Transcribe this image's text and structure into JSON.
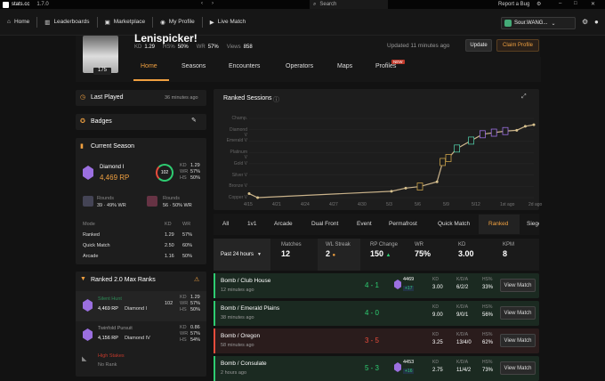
{
  "app": {
    "name": "stats.cc",
    "version": "1.7.0"
  },
  "titlebar": {
    "search_placeholder": "Search",
    "report_bug": "Report a Bug"
  },
  "nav": {
    "home": "Home",
    "leaderboards": "Leaderboards",
    "marketplace": "Marketplace",
    "my_profile": "My Profile",
    "live_match": "Live Match",
    "user": "Sour.WANG..."
  },
  "profile": {
    "name": "Lenispicker!",
    "level": "175",
    "kd_label": "KD",
    "kd": "1.29",
    "hs_label": "HS%",
    "hs": "50%",
    "wr_label": "WR",
    "wr": "57%",
    "views_label": "Views",
    "views": "858",
    "updated": "Updated 11 minutes ago",
    "update_btn": "Update",
    "claim_btn": "Claim Profile"
  },
  "tabs": [
    "Home",
    "Seasons",
    "Encounters",
    "Operators",
    "Maps",
    "Profiles"
  ],
  "new_badge": "NEW",
  "left": {
    "last_played_label": "Last Played",
    "last_played_value": "36 minutes ago",
    "badges_label": "Badges",
    "current_season_label": "Current Season",
    "rank": "Diamond I",
    "rp": "4,469 RP",
    "ring": "102",
    "kd_label": "KD",
    "kd": "1.29",
    "wr_label": "WR",
    "wr": "57%",
    "hs_label": "HS",
    "hs": "50%",
    "rounds1_label": "Rounds",
    "rounds1": "39 · 49% WR",
    "rounds2_label": "Rounds",
    "rounds2": "56 · 50% WR",
    "mode_table": {
      "headers": [
        "Mode",
        "KD",
        "WR"
      ],
      "rows": [
        [
          "Ranked",
          "1.29",
          "57%"
        ],
        [
          "Quick Match",
          "2.50",
          "60%"
        ],
        [
          "Arcade",
          "1.16",
          "50%"
        ]
      ]
    },
    "r2_label": "Ranked 2.0 Max Ranks",
    "r2": [
      {
        "season": "Silent Hunt",
        "rp": "4,469 RP",
        "rank": "Diamond I",
        "ring": "102",
        "kd": "1.29",
        "wr": "57%",
        "hs": "50%"
      },
      {
        "season": "Twinfold Pursuit",
        "rp": "4,156 RP",
        "rank": "Diamond IV",
        "kd": "0.86",
        "wr": "57%",
        "hs": "54%"
      },
      {
        "season": "High Stakes",
        "rp": "",
        "rank": "No Rank"
      }
    ]
  },
  "chart_header": "Ranked Sessions",
  "chart_data": {
    "type": "line",
    "title": "Ranked Sessions",
    "y_categories": [
      "Copper V",
      "Bronze V",
      "Silver V",
      "Gold V",
      "Platinum V",
      "Emerald V",
      "Diamond V",
      "Champ."
    ],
    "x_ticks": [
      "4/15",
      "4/21",
      "4/24",
      "4/27",
      "4/30",
      "5/3",
      "5/6",
      "5/9",
      "5/12",
      "1st ago",
      "2d ago"
    ],
    "x": [
      "4/15",
      "4/21",
      "4/24",
      "4/27",
      "4/30",
      "5/3",
      "5/5",
      "5/6",
      "5/7",
      "5/8",
      "5/9",
      "5/10",
      "5/11",
      "5/12",
      "5/13",
      "2d ago"
    ],
    "y_labels": [
      "Copper V",
      "Bronze V",
      "Silver V",
      "Gold V",
      "Platinum V",
      "Emerald V",
      "Diamond V",
      "Champ."
    ]
  },
  "filters": [
    "All",
    "1v1",
    "Arcade",
    "Dual Front",
    "Event",
    "Permafrost",
    "Quick Match",
    "Ranked",
    "Siege"
  ],
  "summary": {
    "period": "Past 24 hours",
    "matches_label": "Matches",
    "matches": "12",
    "streak_label": "WL Streak",
    "streak": "2",
    "rp_label": "RP Change",
    "rp": "150",
    "wr_label": "WR",
    "wr": "75%",
    "kd_label": "KD",
    "kd": "3.00",
    "kpm_label": "KPM",
    "kpm": "8"
  },
  "matches": [
    {
      "title": "Bomb / Club House",
      "time": "12 minutes ago",
      "score": "4 - 1",
      "rp": "4469",
      "rpd": "+17",
      "kd": "3.00",
      "kda": "6/2/2",
      "hs": "33%",
      "win": true
    },
    {
      "title": "Bomb / Emerald Plains",
      "time": "38 minutes ago",
      "score": "4 - 0",
      "rp": "",
      "rpd": "",
      "kd": "9.00",
      "kda": "9/0/1",
      "hs": "56%",
      "win": true
    },
    {
      "title": "Bomb / Oregon",
      "time": "58 minutes ago",
      "score": "3 - 5",
      "rp": "",
      "rpd": "",
      "kd": "3.25",
      "kda": "13/4/0",
      "hs": "62%",
      "win": false
    },
    {
      "title": "Bomb / Consulate",
      "time": "2 hours ago",
      "score": "5 - 3",
      "rp": "4453",
      "rpd": "+16",
      "kd": "2.75",
      "kda": "11/4/2",
      "hs": "73%",
      "win": true
    }
  ],
  "labels": {
    "kd": "KD",
    "kda": "K/D/A",
    "hs": "HS%",
    "view": "View Match"
  },
  "colors": {
    "win": "#2ecc71",
    "loss": "#e74c3c",
    "accent": "#f0a040"
  }
}
